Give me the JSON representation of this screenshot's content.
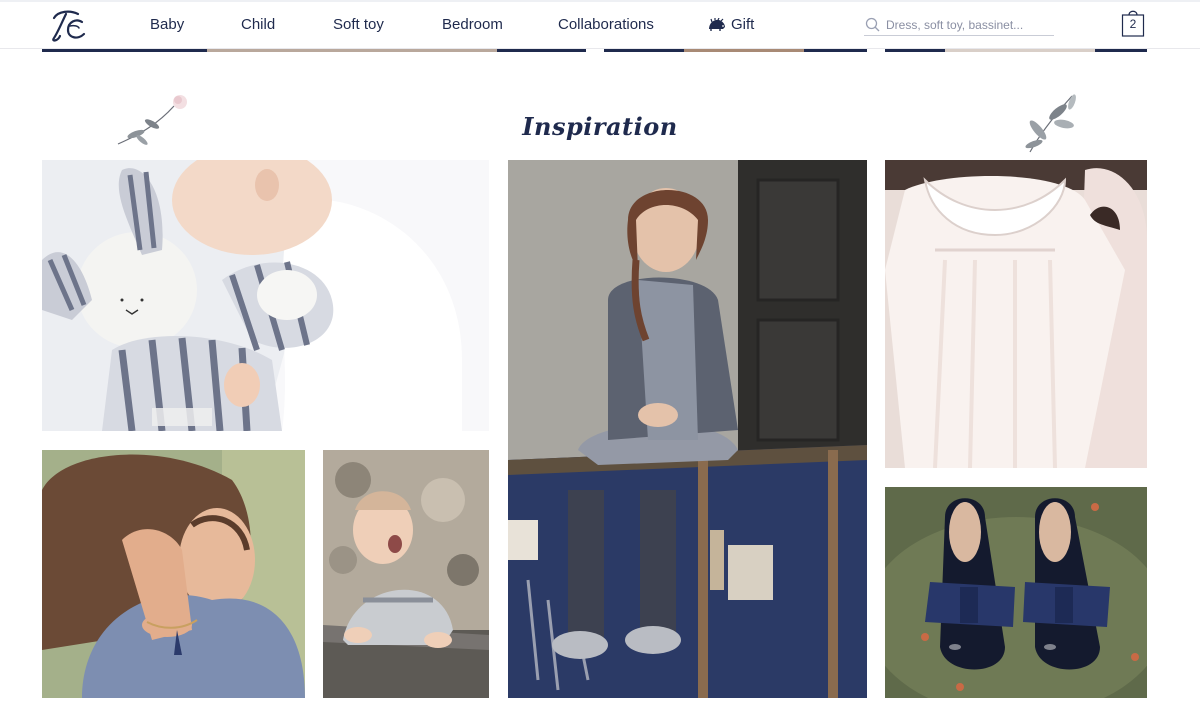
{
  "header": {
    "logo_text": "TC",
    "nav": [
      {
        "label": "Baby"
      },
      {
        "label": "Child"
      },
      {
        "label": "Soft toy"
      },
      {
        "label": "Bedroom"
      },
      {
        "label": "Collaborations"
      },
      {
        "label": "Gift",
        "icon": "hedgehog-icon"
      }
    ],
    "search": {
      "placeholder": "Dress, soft toy, bassinet...",
      "value": "",
      "icon": "search-icon"
    },
    "cart": {
      "count": "2",
      "icon": "shopping-bag-icon"
    }
  },
  "section": {
    "title": "Inspiration"
  },
  "images": [
    {
      "name": "baby-with-striped-bunny"
    },
    {
      "name": "woman-with-tassel-bracelet"
    },
    {
      "name": "laughing-baby-on-stone"
    },
    {
      "name": "girl-sitting-on-trunk"
    },
    {
      "name": "white-dress-on-hanger"
    },
    {
      "name": "navy-bow-shoes"
    }
  ],
  "colors": {
    "brand_navy": "#1f2a4d",
    "background": "#ffffff",
    "divider": "#e8e8ec"
  }
}
